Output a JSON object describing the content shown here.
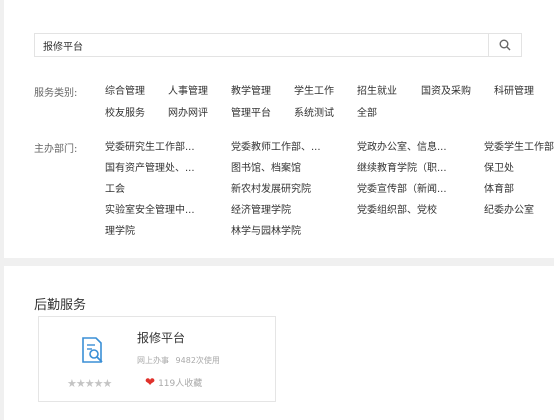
{
  "search": {
    "value": "报修平台",
    "placeholder": ""
  },
  "filters": {
    "category_label": "服务类别:",
    "categories": [
      "综合管理",
      "人事管理",
      "教学管理",
      "学生工作",
      "招生就业",
      "国资及采购",
      "科研管理",
      "校友服务",
      "网办网评",
      "管理平台",
      "系统测试",
      "全部"
    ],
    "department_label": "主办部门:",
    "departments": [
      "党委研究生工作部...",
      "党委教师工作部、...",
      "党政办公室、信息...",
      "党委学生工作部",
      "国有资产管理处、...",
      "图书馆、档案馆",
      "继续教育学院（职...",
      "保卫处",
      "工会",
      "新农村发展研究院",
      "党委宣传部（新闻...",
      "体育部",
      "实验室安全管理中...",
      "经济管理学院",
      "党委组织部、党校",
      "纪委办公室",
      "理学院",
      "林学与园林学院"
    ]
  },
  "section": {
    "title": "后勤服务",
    "card": {
      "name": "报修平台",
      "mode": "网上办事",
      "usage": "9482次使用",
      "stars": "★★★★★",
      "favorites": "119人收藏"
    }
  },
  "colors": {
    "heart": "#e0312b",
    "star": "#c4c4c4"
  }
}
